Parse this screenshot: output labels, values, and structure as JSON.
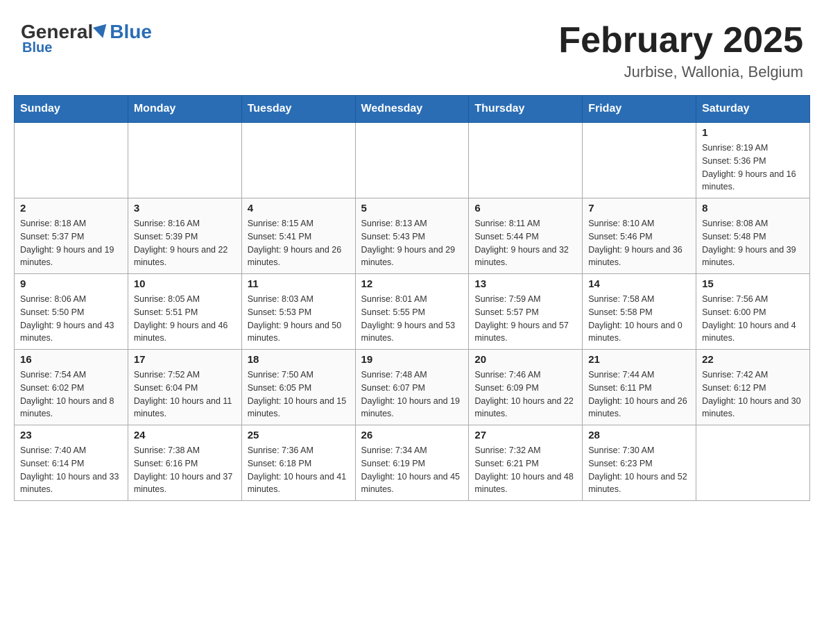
{
  "header": {
    "logo": {
      "general": "General",
      "blue": "Blue"
    },
    "title": "February 2025",
    "location": "Jurbise, Wallonia, Belgium"
  },
  "weekdays": [
    "Sunday",
    "Monday",
    "Tuesday",
    "Wednesday",
    "Thursday",
    "Friday",
    "Saturday"
  ],
  "weeks": [
    [
      {
        "day": "",
        "info": ""
      },
      {
        "day": "",
        "info": ""
      },
      {
        "day": "",
        "info": ""
      },
      {
        "day": "",
        "info": ""
      },
      {
        "day": "",
        "info": ""
      },
      {
        "day": "",
        "info": ""
      },
      {
        "day": "1",
        "info": "Sunrise: 8:19 AM\nSunset: 5:36 PM\nDaylight: 9 hours and 16 minutes."
      }
    ],
    [
      {
        "day": "2",
        "info": "Sunrise: 8:18 AM\nSunset: 5:37 PM\nDaylight: 9 hours and 19 minutes."
      },
      {
        "day": "3",
        "info": "Sunrise: 8:16 AM\nSunset: 5:39 PM\nDaylight: 9 hours and 22 minutes."
      },
      {
        "day": "4",
        "info": "Sunrise: 8:15 AM\nSunset: 5:41 PM\nDaylight: 9 hours and 26 minutes."
      },
      {
        "day": "5",
        "info": "Sunrise: 8:13 AM\nSunset: 5:43 PM\nDaylight: 9 hours and 29 minutes."
      },
      {
        "day": "6",
        "info": "Sunrise: 8:11 AM\nSunset: 5:44 PM\nDaylight: 9 hours and 32 minutes."
      },
      {
        "day": "7",
        "info": "Sunrise: 8:10 AM\nSunset: 5:46 PM\nDaylight: 9 hours and 36 minutes."
      },
      {
        "day": "8",
        "info": "Sunrise: 8:08 AM\nSunset: 5:48 PM\nDaylight: 9 hours and 39 minutes."
      }
    ],
    [
      {
        "day": "9",
        "info": "Sunrise: 8:06 AM\nSunset: 5:50 PM\nDaylight: 9 hours and 43 minutes."
      },
      {
        "day": "10",
        "info": "Sunrise: 8:05 AM\nSunset: 5:51 PM\nDaylight: 9 hours and 46 minutes."
      },
      {
        "day": "11",
        "info": "Sunrise: 8:03 AM\nSunset: 5:53 PM\nDaylight: 9 hours and 50 minutes."
      },
      {
        "day": "12",
        "info": "Sunrise: 8:01 AM\nSunset: 5:55 PM\nDaylight: 9 hours and 53 minutes."
      },
      {
        "day": "13",
        "info": "Sunrise: 7:59 AM\nSunset: 5:57 PM\nDaylight: 9 hours and 57 minutes."
      },
      {
        "day": "14",
        "info": "Sunrise: 7:58 AM\nSunset: 5:58 PM\nDaylight: 10 hours and 0 minutes."
      },
      {
        "day": "15",
        "info": "Sunrise: 7:56 AM\nSunset: 6:00 PM\nDaylight: 10 hours and 4 minutes."
      }
    ],
    [
      {
        "day": "16",
        "info": "Sunrise: 7:54 AM\nSunset: 6:02 PM\nDaylight: 10 hours and 8 minutes."
      },
      {
        "day": "17",
        "info": "Sunrise: 7:52 AM\nSunset: 6:04 PM\nDaylight: 10 hours and 11 minutes."
      },
      {
        "day": "18",
        "info": "Sunrise: 7:50 AM\nSunset: 6:05 PM\nDaylight: 10 hours and 15 minutes."
      },
      {
        "day": "19",
        "info": "Sunrise: 7:48 AM\nSunset: 6:07 PM\nDaylight: 10 hours and 19 minutes."
      },
      {
        "day": "20",
        "info": "Sunrise: 7:46 AM\nSunset: 6:09 PM\nDaylight: 10 hours and 22 minutes."
      },
      {
        "day": "21",
        "info": "Sunrise: 7:44 AM\nSunset: 6:11 PM\nDaylight: 10 hours and 26 minutes."
      },
      {
        "day": "22",
        "info": "Sunrise: 7:42 AM\nSunset: 6:12 PM\nDaylight: 10 hours and 30 minutes."
      }
    ],
    [
      {
        "day": "23",
        "info": "Sunrise: 7:40 AM\nSunset: 6:14 PM\nDaylight: 10 hours and 33 minutes."
      },
      {
        "day": "24",
        "info": "Sunrise: 7:38 AM\nSunset: 6:16 PM\nDaylight: 10 hours and 37 minutes."
      },
      {
        "day": "25",
        "info": "Sunrise: 7:36 AM\nSunset: 6:18 PM\nDaylight: 10 hours and 41 minutes."
      },
      {
        "day": "26",
        "info": "Sunrise: 7:34 AM\nSunset: 6:19 PM\nDaylight: 10 hours and 45 minutes."
      },
      {
        "day": "27",
        "info": "Sunrise: 7:32 AM\nSunset: 6:21 PM\nDaylight: 10 hours and 48 minutes."
      },
      {
        "day": "28",
        "info": "Sunrise: 7:30 AM\nSunset: 6:23 PM\nDaylight: 10 hours and 52 minutes."
      },
      {
        "day": "",
        "info": ""
      }
    ]
  ]
}
